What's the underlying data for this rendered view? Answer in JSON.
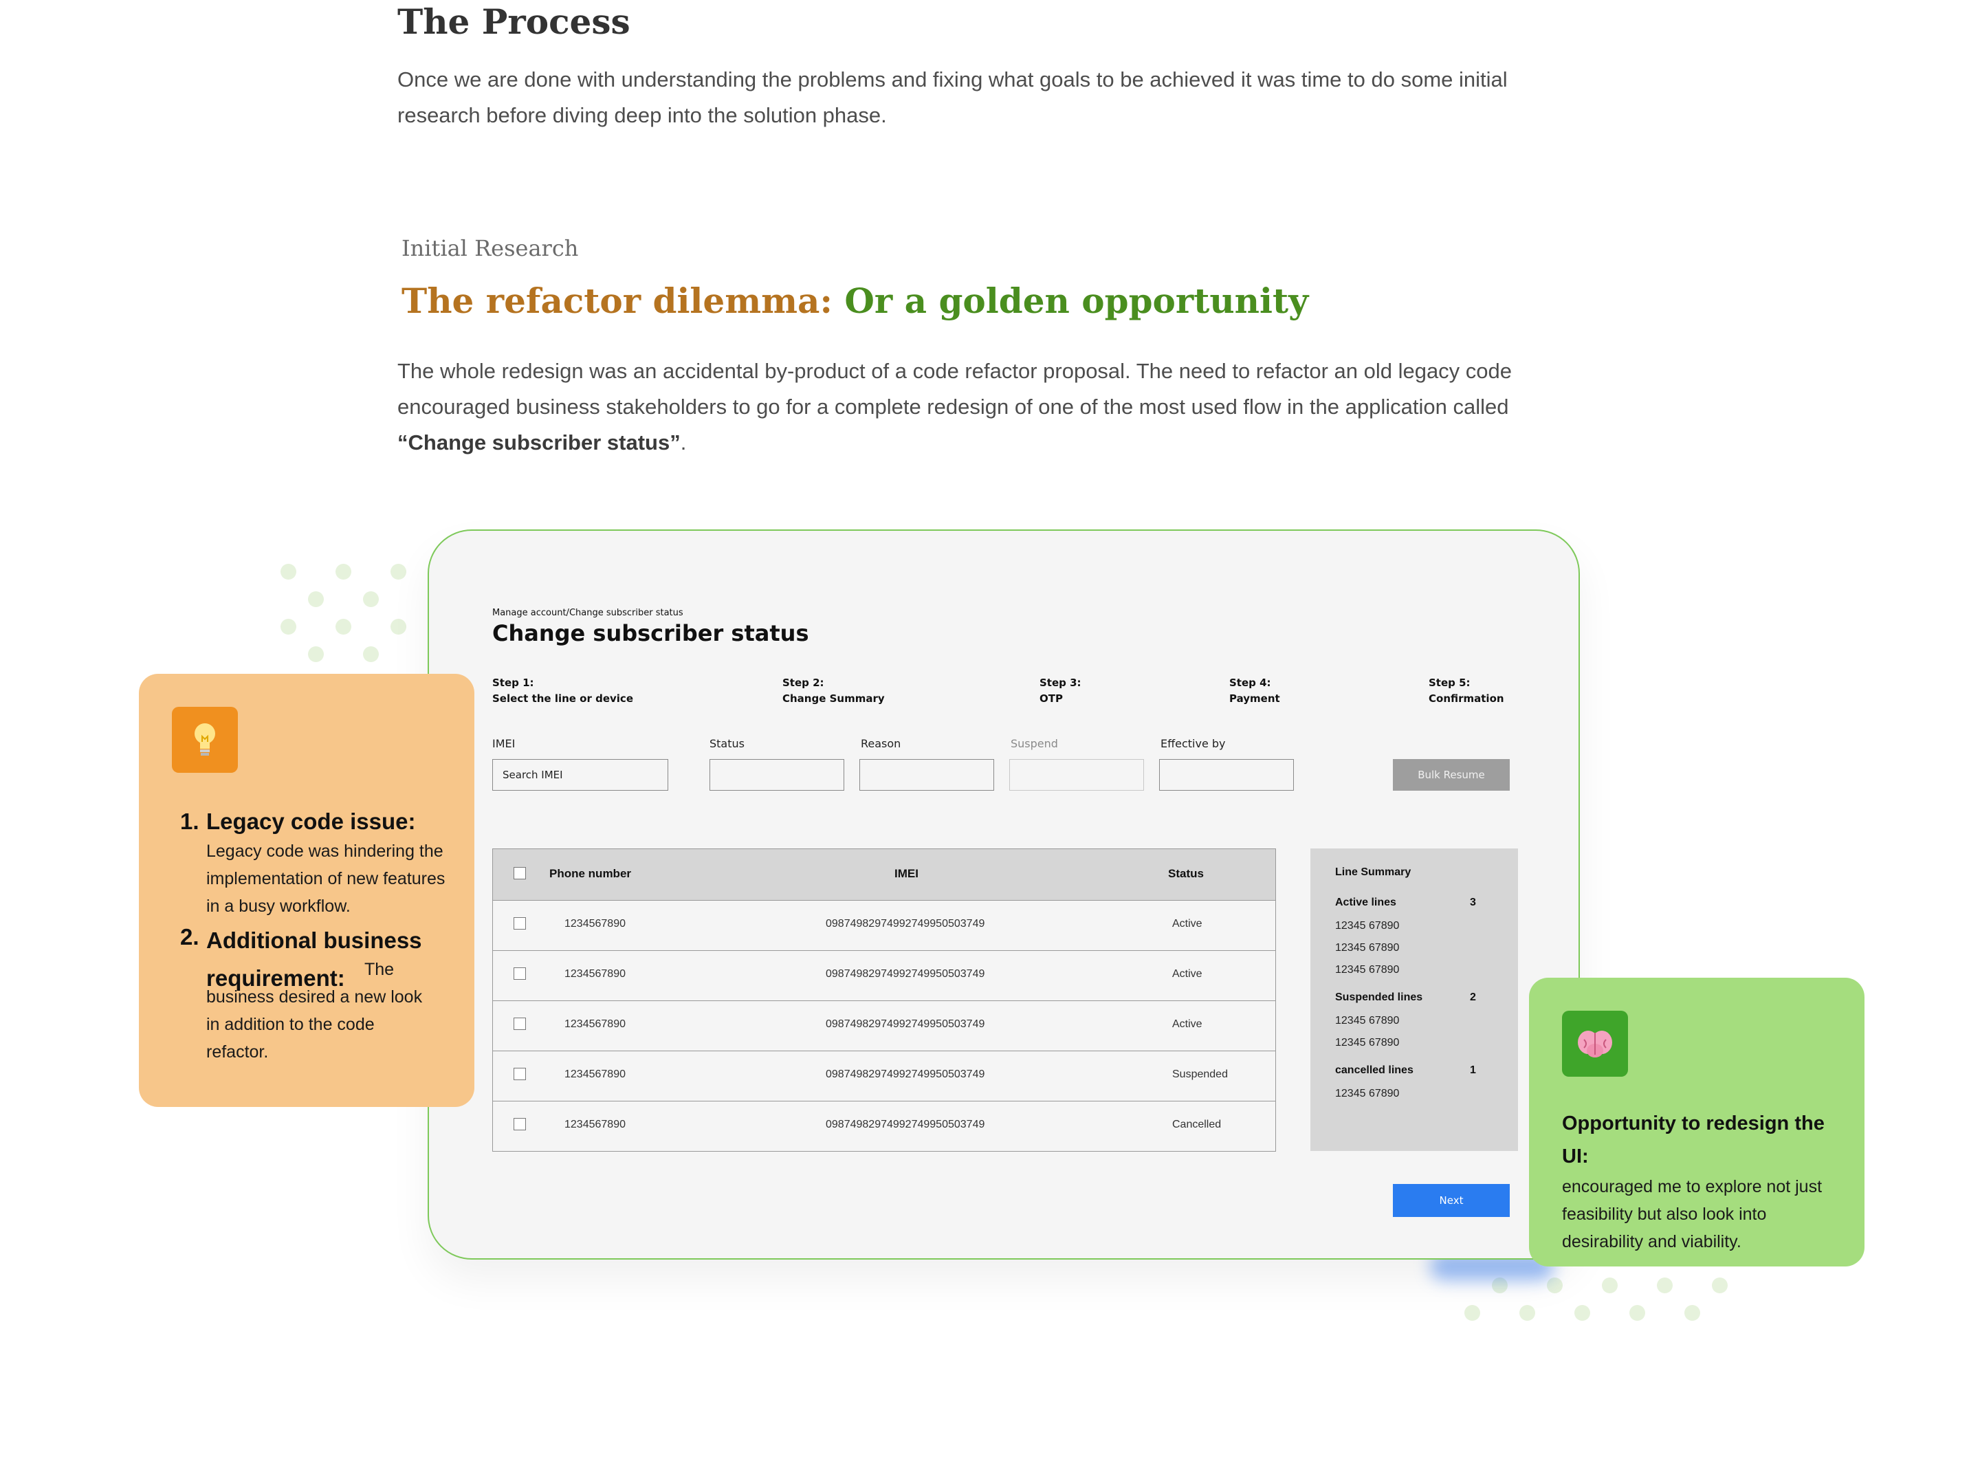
{
  "intro": {
    "title": "The Process",
    "body": "Once we are done with understanding the problems and fixing what goals to be achieved it was time to do some initial research before diving deep into the solution phase."
  },
  "research": {
    "eyebrow": "Initial Research",
    "title_part1": "The refactor dilemma:",
    "title_part2": "Or a golden opportunity",
    "body_text": "The whole redesign was an accidental by-product of a code refactor proposal. The need to refactor an old legacy code encouraged business stakeholders to go for a complete redesign of one of the most used flow in the application called",
    "body_bold": "“Change subscriber status”",
    "body_end": "."
  },
  "mockup": {
    "breadcrumb": "Manage account/Change subscriber status",
    "title": "Change subscriber status",
    "steps": [
      {
        "num": "Step 1:",
        "label": "Select the line or device"
      },
      {
        "num": "Step 2:",
        "label": "Change Summary"
      },
      {
        "num": "Step 3:",
        "label": "OTP"
      },
      {
        "num": "Step 4:",
        "label": "Payment"
      },
      {
        "num": "Step 5:",
        "label": "Confirmation"
      }
    ],
    "fields": {
      "imei_label": "IMEI",
      "imei_placeholder": "Search IMEI",
      "status_label": "Status",
      "reason_label": "Reason",
      "suspend_label": "Suspend",
      "effective_label": "Effective by"
    },
    "bulk_resume": "Bulk Resume",
    "table": {
      "headers": [
        "Phone number",
        "IMEI",
        "Status"
      ],
      "rows": [
        {
          "phone": "1234567890",
          "imei": "09874982974992749950503749",
          "status": "Active"
        },
        {
          "phone": "1234567890",
          "imei": "09874982974992749950503749",
          "status": "Active"
        },
        {
          "phone": "1234567890",
          "imei": "09874982974992749950503749",
          "status": "Active"
        },
        {
          "phone": "1234567890",
          "imei": "09874982974992749950503749",
          "status": "Suspended"
        },
        {
          "phone": "1234567890",
          "imei": "09874982974992749950503749",
          "status": "Cancelled"
        }
      ]
    },
    "summary": {
      "title": "Line Summary",
      "active_label": "Active lines",
      "active_count": "3",
      "active_lines": [
        "12345 67890",
        "12345 67890",
        "12345 67890"
      ],
      "suspended_label": "Suspended lines",
      "suspended_count": "2",
      "suspended_lines": [
        "12345 67890",
        "12345 67890"
      ],
      "cancelled_label": "cancelled lines",
      "cancelled_count": "1",
      "cancelled_lines": [
        "12345 67890"
      ]
    },
    "next": "Next"
  },
  "card_left": {
    "icon": "lightbulb-icon",
    "item1_num": "1.",
    "item1_title": "Legacy code issue:",
    "item1_body": "Legacy code was hindering the implementation of new features in a busy workflow.",
    "item2_num": "2.",
    "item2_title": "Additional business requirement:",
    "item2_body": "The business desired a new look in addition to the code refactor."
  },
  "card_right": {
    "icon": "brain-icon",
    "title": "Opportunity to redesign the UI:",
    "body": "encouraged me to explore not just feasibility but also look into desirability and viability."
  },
  "colors": {
    "accent_orange": "#b57320",
    "accent_green": "#4a8e1f",
    "card_orange": "#f7c68a",
    "card_green": "#a5dd7e",
    "next_blue": "#2a7cf0"
  }
}
